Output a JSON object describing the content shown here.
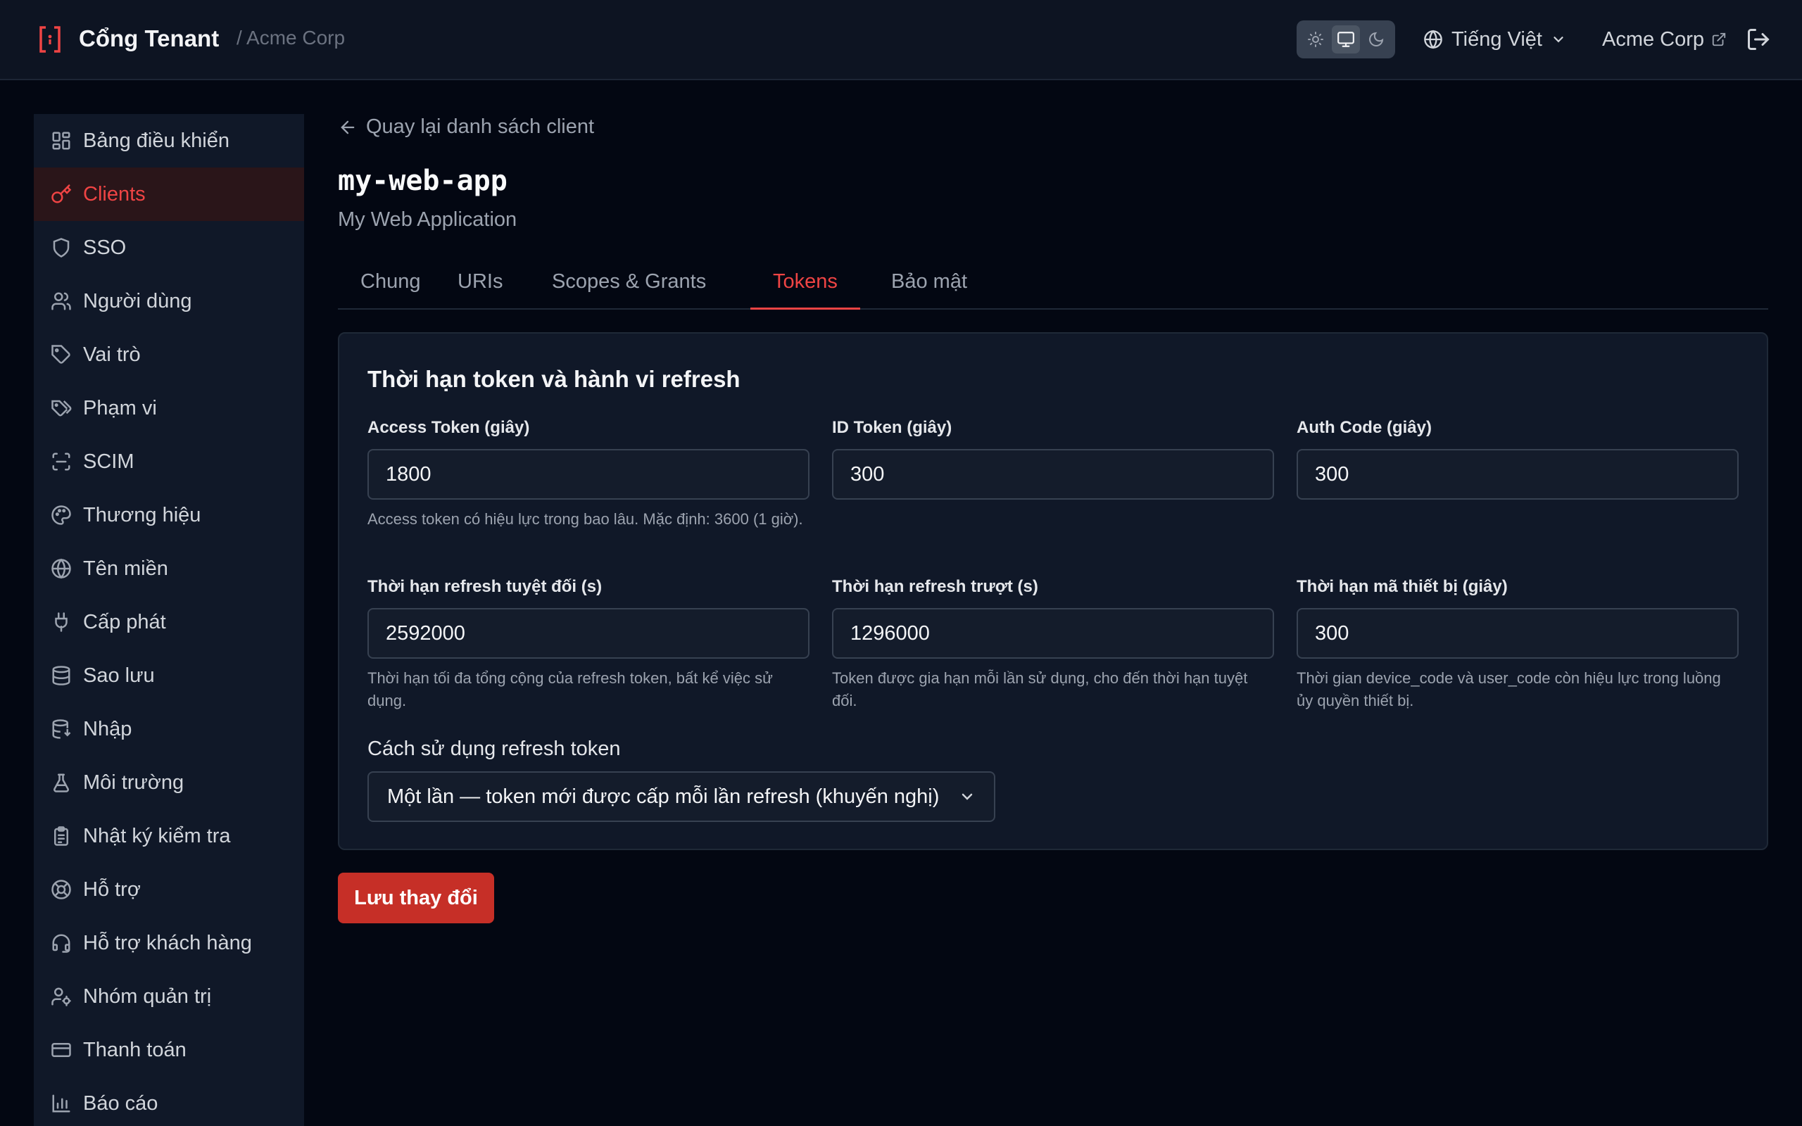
{
  "header": {
    "title": "Cổng Tenant",
    "tenant": "/ Acme Corp",
    "language": "Tiếng Việt",
    "tenant_link": "Acme Corp",
    "theme_modes": [
      "sun-icon",
      "monitor-icon",
      "moon-icon"
    ],
    "active_theme": "monitor"
  },
  "sidebar": {
    "items": [
      {
        "label": "Bảng điều khiển",
        "icon": "dashboard-icon"
      },
      {
        "label": "Clients",
        "icon": "key-icon",
        "active": true
      },
      {
        "label": "SSO",
        "icon": "shield-icon"
      },
      {
        "label": "Người dùng",
        "icon": "users-icon"
      },
      {
        "label": "Vai trò",
        "icon": "tag-icon"
      },
      {
        "label": "Phạm vi",
        "icon": "tags-icon"
      },
      {
        "label": "SCIM",
        "icon": "scan-icon"
      },
      {
        "label": "Thương hiệu",
        "icon": "palette-icon"
      },
      {
        "label": "Tên miền",
        "icon": "globe-icon"
      },
      {
        "label": "Cấp phát",
        "icon": "plug-icon"
      },
      {
        "label": "Sao lưu",
        "icon": "database-icon"
      },
      {
        "label": "Nhập",
        "icon": "database-import-icon"
      },
      {
        "label": "Môi trường",
        "icon": "flask-icon"
      },
      {
        "label": "Nhật ký kiểm tra",
        "icon": "clipboard-icon"
      },
      {
        "label": "Hỗ trợ",
        "icon": "lifebuoy-icon"
      },
      {
        "label": "Hỗ trợ khách hàng",
        "icon": "headset-icon"
      },
      {
        "label": "Nhóm quản trị",
        "icon": "user-cog-icon"
      },
      {
        "label": "Thanh toán",
        "icon": "credit-card-icon"
      },
      {
        "label": "Báo cáo",
        "icon": "bar-chart-icon"
      }
    ]
  },
  "main": {
    "back_label": "Quay lại danh sách client",
    "client_id": "my-web-app",
    "client_name": "My Web Application",
    "tabs": [
      {
        "label": "Chung"
      },
      {
        "label": "URIs"
      },
      {
        "label": "Scopes & Grants"
      },
      {
        "label": "Tokens",
        "active": true
      },
      {
        "label": "Bảo mật"
      }
    ],
    "card": {
      "title": "Thời hạn token và hành vi refresh",
      "fields": [
        {
          "label": "Access Token (giây)",
          "value": "1800",
          "help": "Access token có hiệu lực trong bao lâu. Mặc định: 3600 (1 giờ)."
        },
        {
          "label": "ID Token (giây)",
          "value": "300",
          "help": ""
        },
        {
          "label": "Auth Code (giây)",
          "value": "300",
          "help": ""
        },
        {
          "label": "Thời hạn refresh tuyệt đối (s)",
          "value": "2592000",
          "help": "Thời hạn tối đa tổng cộng của refresh token, bất kể việc sử dụng."
        },
        {
          "label": "Thời hạn refresh trượt (s)",
          "value": "1296000",
          "help": "Token được gia hạn mỗi lần sử dụng, cho đến thời hạn tuyệt đối."
        },
        {
          "label": "Thời hạn mã thiết bị (giây)",
          "value": "300",
          "help": "Thời gian device_code và user_code còn hiệu lực trong luồng ủy quyền thiết bị."
        }
      ],
      "refresh_usage_label": "Cách sử dụng refresh token",
      "refresh_usage_value": "Một lần — token mới được cấp mỗi lần refresh (khuyến nghị)"
    },
    "save_label": "Lưu thay đổi"
  },
  "colors": {
    "accent": "#ef4444",
    "button": "#c62f27",
    "background": "#030712",
    "panel": "#101828"
  }
}
